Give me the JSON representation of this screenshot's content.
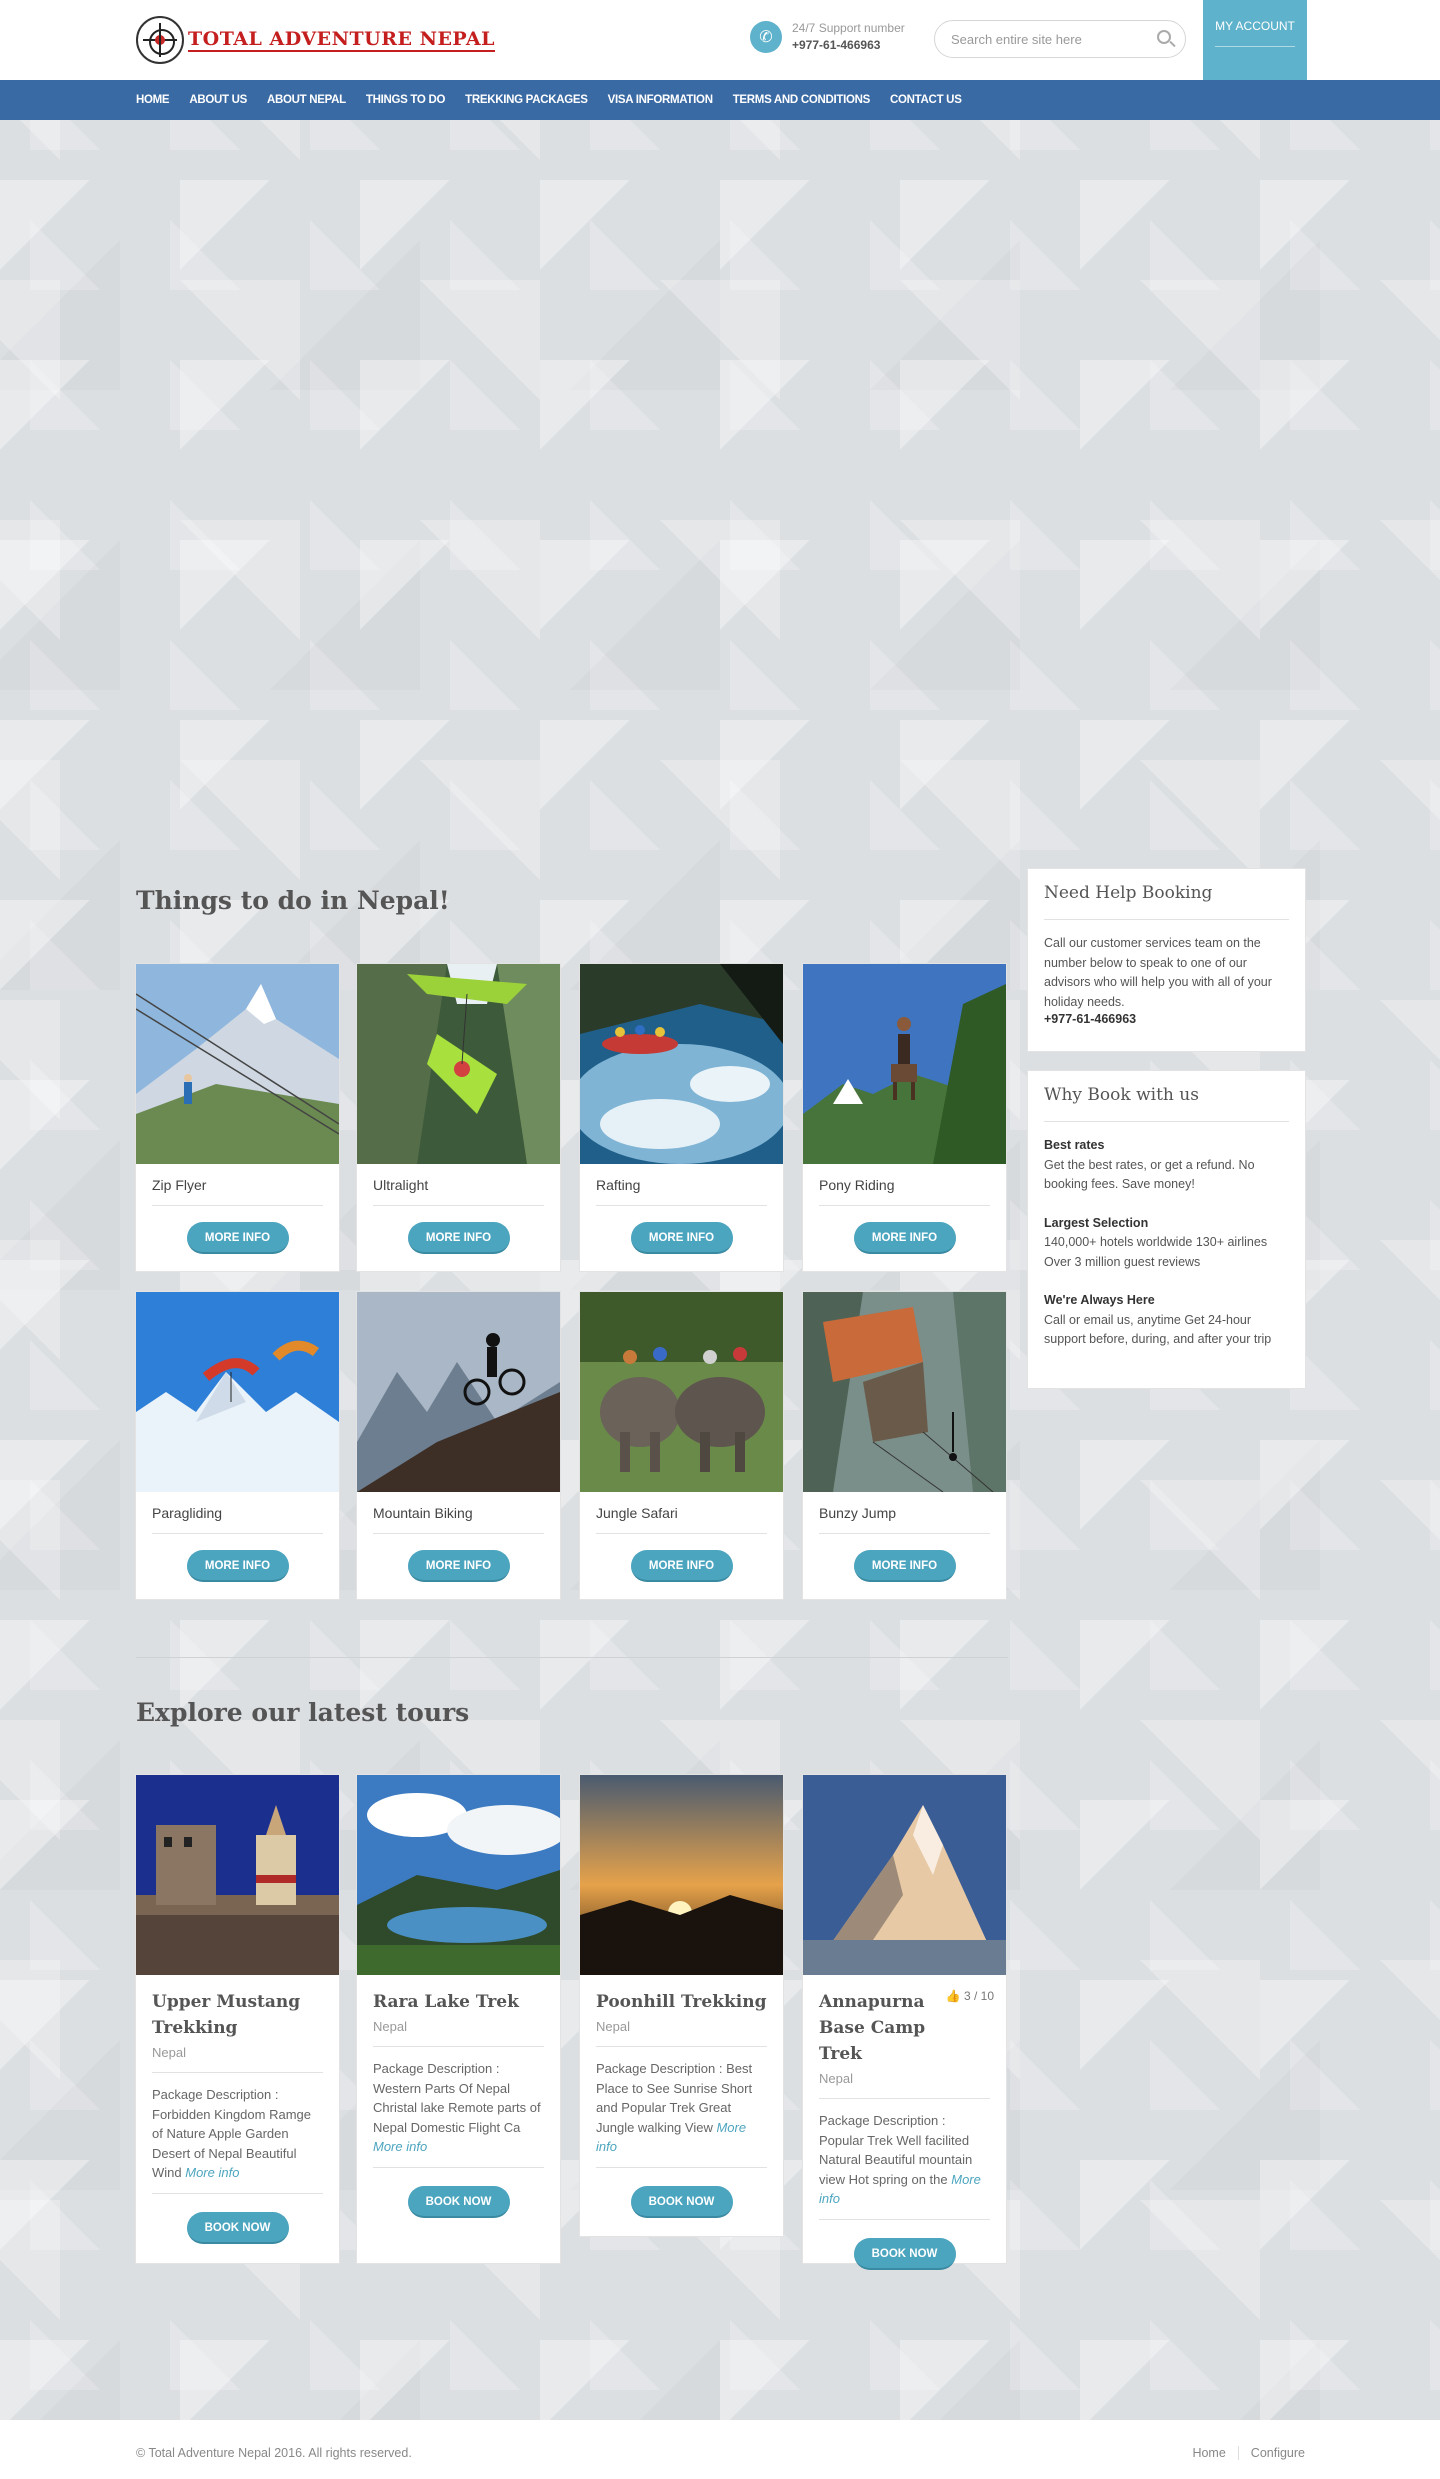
{
  "header": {
    "logo_text": "TOTAL ADVENTURE NEPAL",
    "support_label": "24/7 Support number",
    "support_phone": "+977-61-466963",
    "search_placeholder": "Search entire site here",
    "account_label": "MY ACCOUNT"
  },
  "nav": [
    "HOME",
    "ABOUT US",
    "ABOUT NEPAL",
    "THINGS TO DO",
    "TREKKING PACKAGES",
    "VISA INFORMATION",
    "TERMS AND CONDITIONS",
    "CONTACT US"
  ],
  "things": {
    "title": "Things to do in Nepal!",
    "button_label": "MORE INFO",
    "items": [
      "Zip Flyer",
      "Ultralight",
      "Rafting",
      "Pony Riding",
      "Paragliding",
      "Mountain Biking",
      "Jungle Safari",
      "Bunzy Jump"
    ]
  },
  "tours": {
    "title": "Explore our latest tours",
    "button_label": "BOOK NOW",
    "more_label": "More info",
    "items": [
      {
        "title": "Upper Mustang Trekking",
        "location": "Nepal",
        "desc": "Package Description : Forbidden Kingdom Ramge of Nature Apple Garden Desert of Nepal Beautiful Wind"
      },
      {
        "title": "Rara Lake Trek",
        "location": "Nepal",
        "desc": "Package Description : Western Parts Of Nepal Christal lake Remote parts of Nepal Domestic Flight Ca"
      },
      {
        "title": "Poonhill Trekking",
        "location": "Nepal",
        "desc": "Package Description : Best Place to See Sunrise  Short and Popular Trek Great Jungle walking  View"
      },
      {
        "title": "Annapurna Base Camp Trek",
        "location": "Nepal",
        "rating": "3 / 10",
        "desc": "Package Description : Popular Trek Well facilited Natural Beautiful mountain view Hot spring on the"
      }
    ]
  },
  "sidebar": {
    "help_title": "Need Help Booking",
    "help_text": "Call our customer services team on the number below to speak to one of our advisors who will help you with all of your holiday needs.",
    "help_phone": "+977-61-466963",
    "why_title": "Why Book with us",
    "why_items": [
      {
        "head": "Best rates",
        "text": "Get the best rates, or get a refund. No booking fees. Save money!"
      },
      {
        "head": "Largest Selection",
        "text": "140,000+ hotels worldwide 130+ airlines Over 3 million guest reviews"
      },
      {
        "head": "We're Always Here",
        "text": "Call or email us, anytime Get 24-hour support before, during, and after your trip"
      }
    ]
  },
  "footer": {
    "copyright": "© Total Adventure Nepal 2016. All rights reserved.",
    "links": [
      "Home",
      "Configure"
    ]
  },
  "colors": {
    "accent": "#4ca5bf",
    "nav": "#3a6aa3",
    "logo": "#c41e1e"
  }
}
